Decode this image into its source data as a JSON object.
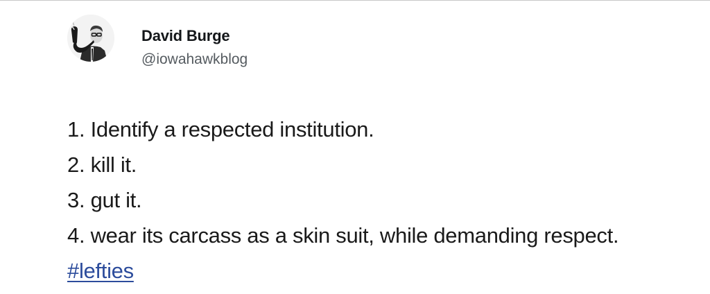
{
  "author": {
    "name": "David Burge",
    "handle": "@iowahawkblog",
    "avatar_icon": "profile-photo-man-with-pipe"
  },
  "tweet": {
    "lines": [
      "1. Identify a respected institution.",
      "2. kill it.",
      "3. gut it.",
      "4. wear its carcass as a skin suit, while demanding respect."
    ],
    "hashtag": "#lefties"
  },
  "colors": {
    "link": "#2c4c9c",
    "text": "#1a1a1a",
    "handle": "#555b60"
  }
}
